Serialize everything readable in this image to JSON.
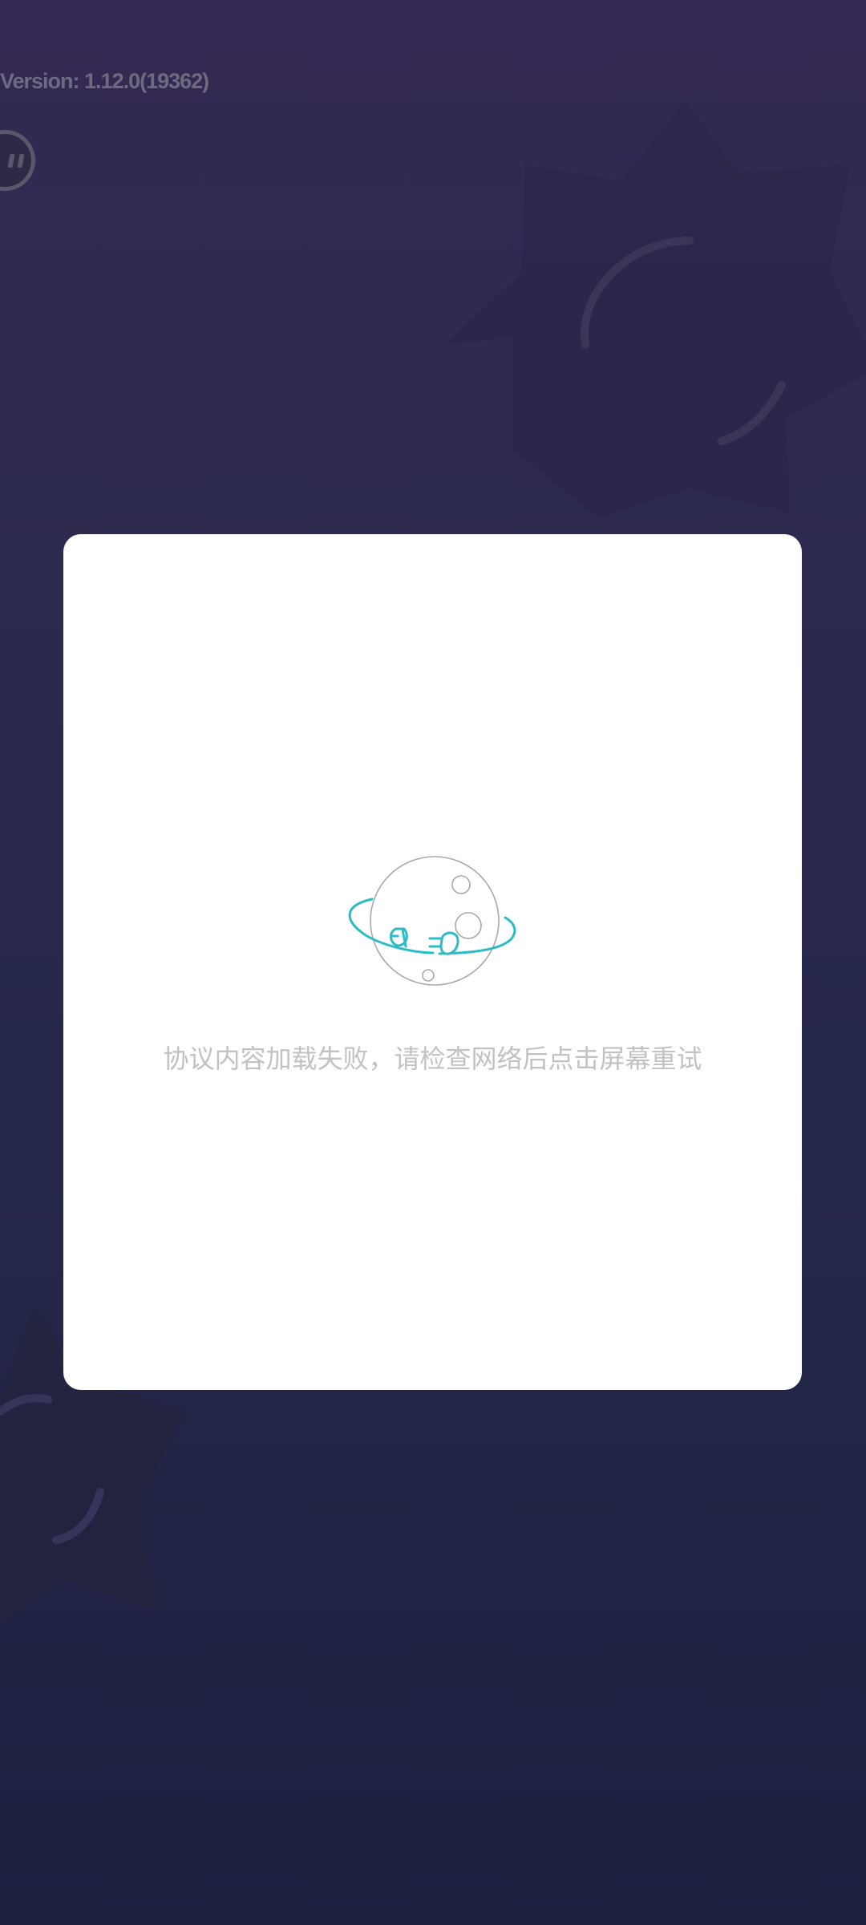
{
  "app": {
    "version_text": "Version: 1.12.0(19362)"
  },
  "dialog": {
    "error_icon": "disconnected-planet-icon",
    "message": "协议内容加载失败，请检查网络后点击屏幕重试"
  },
  "floating_button": {
    "icon": "assistant-face-icon"
  },
  "colors": {
    "background_top": "#342954",
    "background_bottom": "#1d1f3f",
    "card": "#ffffff",
    "accent": "#2bbcc6",
    "message_text": "#c2c2c2"
  }
}
